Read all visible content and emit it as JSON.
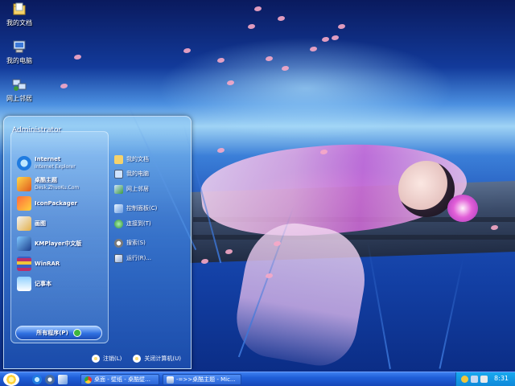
{
  "desktop": {
    "icons": [
      {
        "label": "我的文档",
        "icon": "folder-icon"
      },
      {
        "label": "我的电脑",
        "icon": "computer-icon"
      },
      {
        "label": "网上邻居",
        "icon": "network-icon"
      }
    ]
  },
  "start_menu": {
    "user": "Administrator",
    "pinned": [
      {
        "title": "Internet",
        "subtitle": "Internet Explorer",
        "icon": "ie-icon"
      },
      {
        "title": "桌酷主题",
        "subtitle": "Desk.ZhuoKu.Com",
        "icon": "zhuoku-icon"
      }
    ],
    "recent": [
      {
        "title": "IconPackager",
        "icon": "iconpackager-icon"
      },
      {
        "title": "画图",
        "icon": "paint-icon"
      },
      {
        "title": "KMPlayer中文版",
        "icon": "kmplayer-icon"
      },
      {
        "title": "WinRAR",
        "icon": "winrar-icon"
      },
      {
        "title": "记事本",
        "icon": "notepad-icon"
      }
    ],
    "places": [
      {
        "label": "我的文档",
        "icon": "documents-icon"
      },
      {
        "label": "我的电脑",
        "icon": "computer-icon"
      },
      {
        "label": "网上邻居",
        "icon": "network-icon"
      },
      {
        "label": "控制面板(C)",
        "icon": "control-panel-icon"
      },
      {
        "label": "连接到(T)",
        "icon": "connect-icon"
      },
      {
        "label": "搜索(S)",
        "icon": "search-icon"
      },
      {
        "label": "运行(R)...",
        "icon": "run-icon"
      }
    ],
    "all_programs": "所有程序(P)",
    "logoff": "注销(L)",
    "shutdown": "关闭计算机(U)"
  },
  "taskbar": {
    "tasks": [
      {
        "label": "桌面 - 壁纸 - 桌酷壁…",
        "icon": "chrome-icon"
      },
      {
        "label": "-=>>桌酷主题 - Mic...",
        "icon": "window-icon"
      }
    ],
    "clock": "8:31"
  },
  "colors": {
    "taskbar": "#1f5ed8",
    "tray": "#0e86d8",
    "start_menu": "#5096e1"
  }
}
